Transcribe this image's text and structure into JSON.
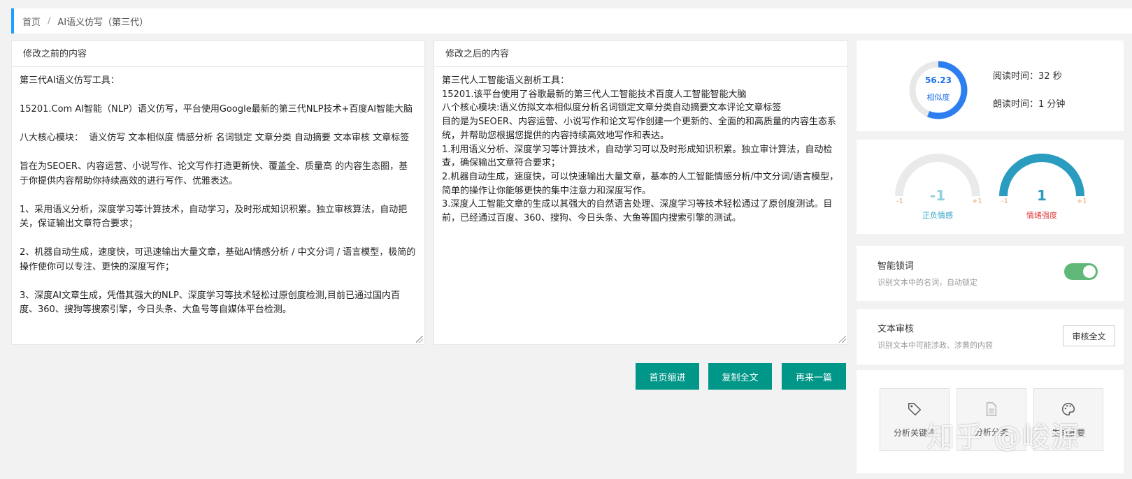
{
  "breadcrumb": {
    "home": "首页",
    "separator": "/",
    "current": "AI语义仿写（第三代）"
  },
  "left_panel": {
    "title": "修改之前的内容",
    "content": "第三代AI语义仿写工具：\n\n15201.Com AI智能（NLP）语义仿写，平台使用Google最新的第三代NLP技术+百度AI智能大脑\n\n八大核心模块：  语义仿写 文本相似度 情感分析 名词锁定 文章分类 自动摘要 文本审核 文章标签\n\n旨在为SEOER、内容运营、小说写作、论文写作打造更新快、覆盖全、质量高 的内容生态圈，基于你提供内容帮助你持续高效的进行写作、优雅表达。\n\n1、采用语义分析，深度学习等计算技术，自动学习，及时形成知识积累。独立审核算法，自动把关，保证输出文章符合要求；\n\n2、机器自动生成，速度快，可迅速输出大量文章，基础AI情感分析 / 中文分词 / 语言模型，极简的操作使你可以专注、更快的深度写作；\n\n3、深度AI文章生成，凭借其强大的NLP、深度学习等技术轻松过原创度检测,目前已通过国内百度、360、搜狗等搜索引擎，今日头条、大鱼号等自媒体平台检测。"
  },
  "right_panel": {
    "title": "修改之后的内容",
    "content": "第三代人工智能语义剖析工具：\n15201.该平台使用了谷歌最新的第三代人工智能技术百度人工智能智能大脑\n八个核心模块:语义仿拟文本相似度分析名词锁定文章分类自动摘要文本评论文章标签\n目的是为SEOER、内容运营、小说写作和论文写作创建一个更新的、全面的和高质量的内容生态系统，并帮助您根据您提供的内容持续高效地写作和表达。\n1.利用语义分析、深度学习等计算技术，自动学习可以及时形成知识积累。独立审计算法，自动检查，确保输出文章符合要求；\n2.机器自动生成，速度快，可以快速输出大量文章，基本的人工智能情感分析/中文分词/语言模型，简单的操作让你能够更快的集中注意力和深度写作。\n3.深度人工智能文章的生成以其强大的自然语言处理、深度学习等技术轻松通过了原创度测试。目前，已经通过百度、360、搜狗、今日头条、大鱼等国内搜索引擎的测试。"
  },
  "actions": {
    "indent": "首页缩进",
    "copy": "复制全文",
    "again": "再来一篇"
  },
  "similarity": {
    "value": "56.23",
    "percent": 56.23,
    "label": "相似度"
  },
  "reading": {
    "read_label": "阅读时间：",
    "read_value": "32 秒",
    "speak_label": "朗读时间：",
    "speak_value": "1 分钟"
  },
  "sentiment": {
    "value": "-1",
    "level": -1,
    "label": "正负情感",
    "min": "-1",
    "max": "+1"
  },
  "intensity": {
    "value": "1",
    "level": 1,
    "label": "情绪强度",
    "min": "-1",
    "max": "+1"
  },
  "noun_lock": {
    "title": "智能锁词",
    "desc": "识别文本中的名词，自动锁定",
    "enabled": true
  },
  "text_review": {
    "title": "文本审核",
    "desc": "识别文本中可能涉政、涉黄的内容",
    "button": "审核全文"
  },
  "tools": [
    {
      "label": "分析关键词",
      "icon": "tag-icon"
    },
    {
      "label": "分析分类",
      "icon": "document-icon"
    },
    {
      "label": "生成摘要",
      "icon": "palette-icon"
    }
  ],
  "watermark": "知乎 @峻源",
  "colors": {
    "accent": "#1e9fff",
    "button": "#009688",
    "ring": "#2d7ff0",
    "sentiment": "#2fa3c7",
    "intensity": "#2a9cc0",
    "intensity_label": "#e03a3a",
    "toggle": "#5fb878"
  }
}
